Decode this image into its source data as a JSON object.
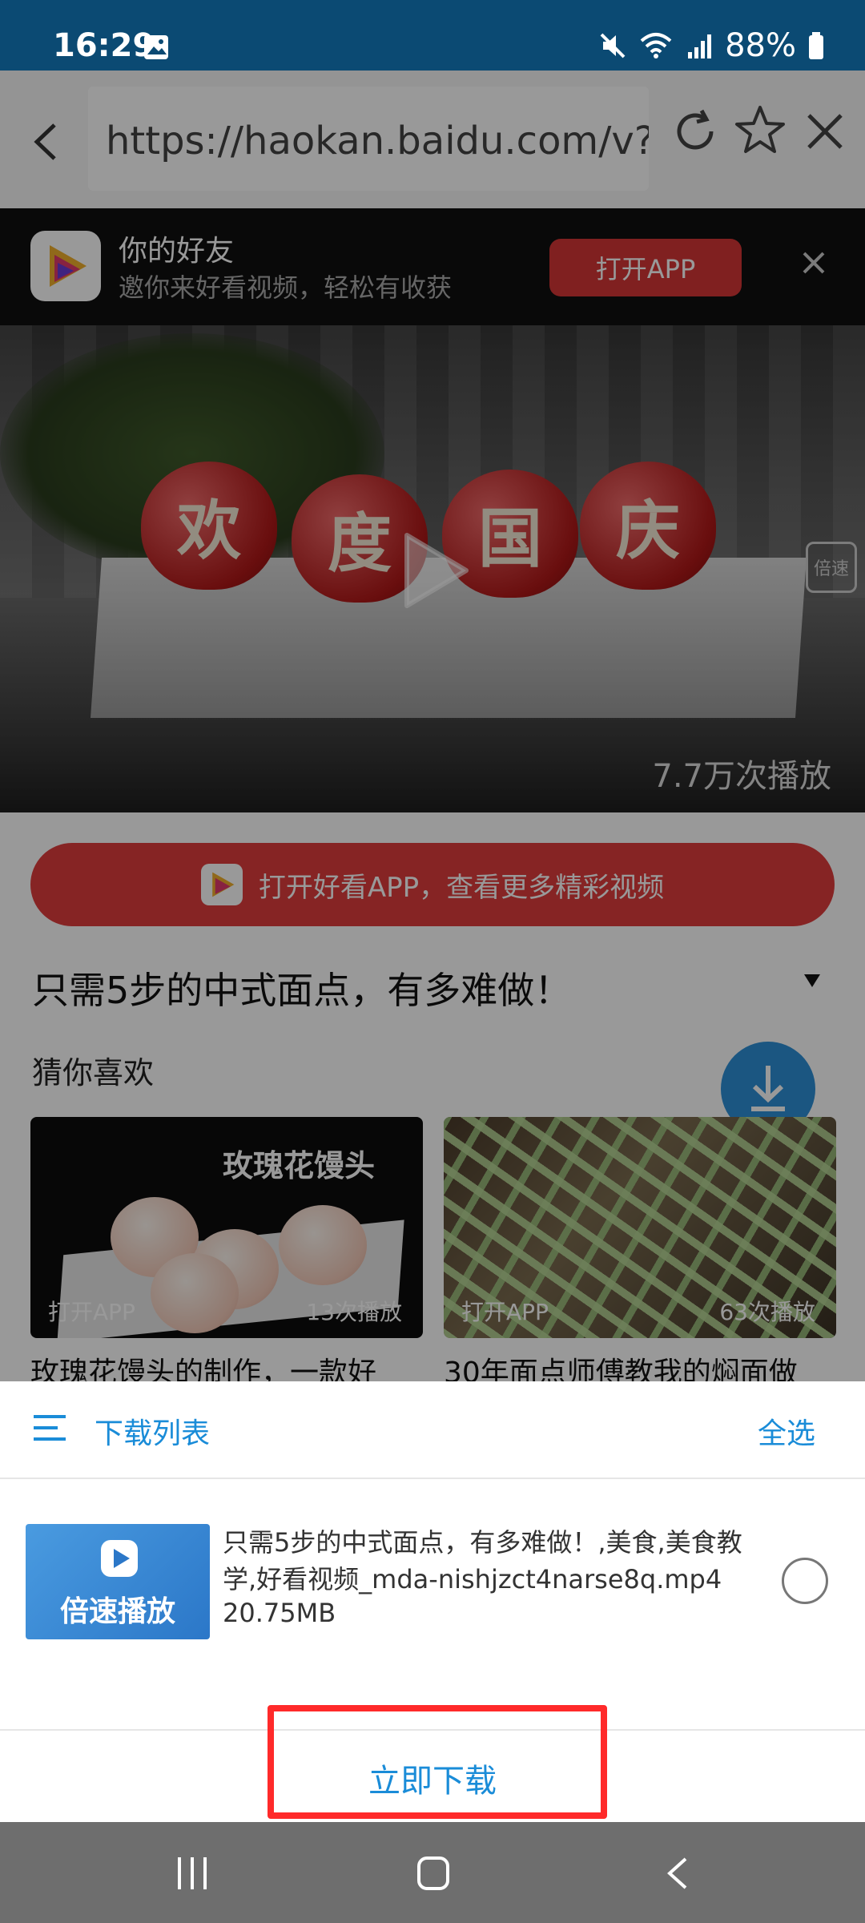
{
  "status_bar": {
    "time": "16:29",
    "battery": "88%"
  },
  "browser": {
    "url": "https://haokan.baidu.com/v?p"
  },
  "banner": {
    "title": "你的好友",
    "subtitle": "邀你来好看视频，轻松有收获",
    "open_button": "打开APP"
  },
  "video": {
    "apple_chars": [
      "欢",
      "度",
      "国",
      "庆"
    ],
    "speed_label": "倍速",
    "views": "7.7万次播放"
  },
  "page": {
    "cta_label": "打开好看APP，查看更多精彩视频",
    "video_title": "只需5步的中式面点，有多难做！",
    "recommend_title": "猜你喜欢",
    "recommendations": [
      {
        "overlay_text": "玫瑰花馒头",
        "open_label": "打开APP",
        "play_count": "13次播放",
        "caption": "玫瑰花馒头的制作，一款好"
      },
      {
        "overlay_text": "",
        "open_label": "打开APP",
        "play_count": "63次播放",
        "caption": "30年面点师傅教我的焖面做"
      }
    ]
  },
  "download_sheet": {
    "title": "下载列表",
    "select_all": "全选",
    "item": {
      "thumb_label": "倍速播放",
      "file_name": "只需5步的中式面点，有多难做！,美食,美食教学,好看视频_mda-nishjzct4narse8q.mp4",
      "file_size": "20.75MB",
      "selected": false
    },
    "download_button": "立即下载"
  },
  "colors": {
    "accent_blue": "#1a8cd8",
    "brand_red": "#e03d3d",
    "highlight_red": "#ff2a2a",
    "status_bar": "#0b4a73"
  }
}
